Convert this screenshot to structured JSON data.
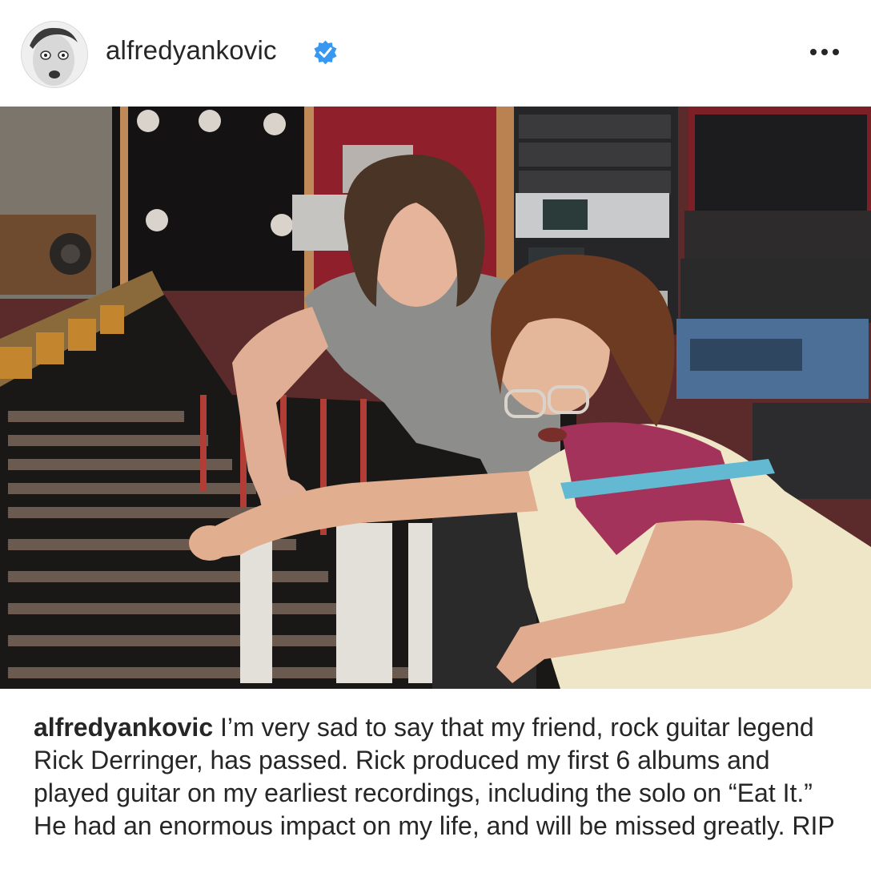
{
  "post": {
    "username": "alfredyankovic",
    "verified_icon": "verified-badge-icon",
    "more_icon": "more-options-icon",
    "photo_description_icon": "studio-photo"
  },
  "caption": {
    "username": "alfredyankovic",
    "text": " I’m very sad to say that my friend, rock guitar legend Rick Derringer, has passed. Rick produced my first 6 albums and played guitar on my earliest recordings, including the solo on “Eat It.” He had an enormous impact on my life, and will be missed greatly. RIP"
  },
  "colors": {
    "verified_blue": "#3897f0",
    "text": "#262626"
  }
}
